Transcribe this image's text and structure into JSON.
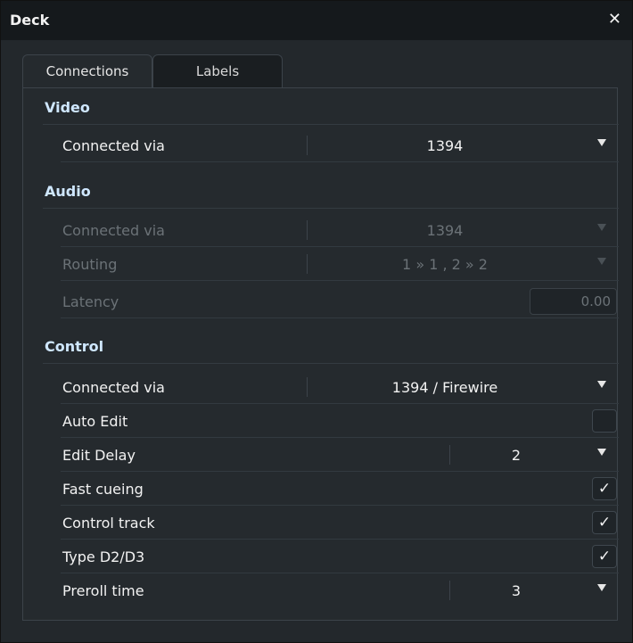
{
  "window": {
    "title": "Deck",
    "close_glyph": "✕"
  },
  "tabs": [
    {
      "label": "Connections",
      "active": true
    },
    {
      "label": "Labels",
      "active": false
    }
  ],
  "sections": {
    "video": {
      "title": "Video",
      "connected_via_label": "Connected via",
      "connected_via_value": "1394"
    },
    "audio": {
      "title": "Audio",
      "connected_via_label": "Connected via",
      "connected_via_value": "1394",
      "routing_label": "Routing",
      "routing_value": "1 » 1 , 2 » 2",
      "latency_label": "Latency",
      "latency_value": "0.00"
    },
    "control": {
      "title": "Control",
      "connected_via_label": "Connected via",
      "connected_via_value": "1394 / Firewire",
      "auto_edit_label": "Auto Edit",
      "auto_edit_checked": false,
      "edit_delay_label": "Edit Delay",
      "edit_delay_value": "2",
      "fast_cueing_label": "Fast cueing",
      "fast_cueing_checked": true,
      "control_track_label": "Control track",
      "control_track_checked": true,
      "type_d2d3_label": "Type D2/D3",
      "type_d2d3_checked": true,
      "preroll_time_label": "Preroll time",
      "preroll_time_value": "3"
    }
  },
  "glyphs": {
    "check": "✓"
  },
  "icons": {
    "close": "close-icon",
    "dropdown": "chevron-down-icon",
    "check": "check-icon"
  }
}
